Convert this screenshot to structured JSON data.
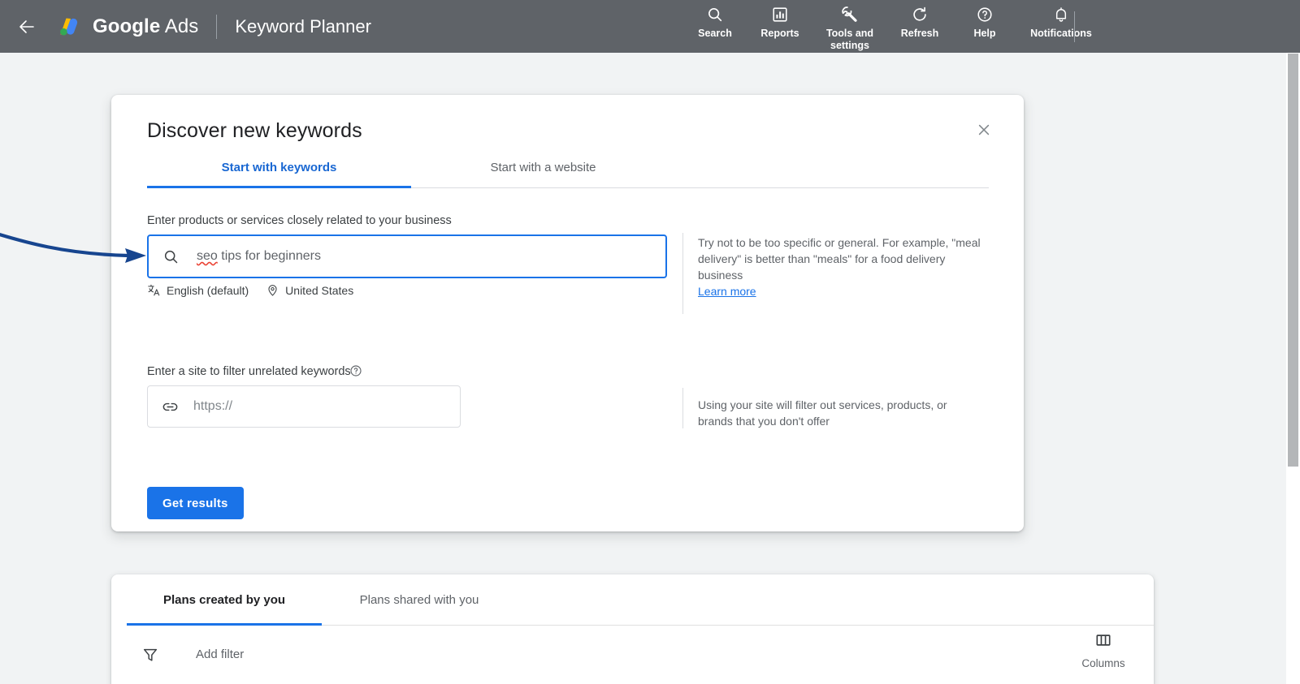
{
  "header": {
    "back_icon": "back-arrow-icon",
    "logo": "google-ads-logo",
    "brand_google": "Google",
    "brand_ads": "Ads",
    "page_name": "Keyword Planner",
    "actions": [
      {
        "label": "Search",
        "icon": "search-icon"
      },
      {
        "label": "Reports",
        "icon": "bar-chart-icon"
      },
      {
        "label": "Tools and settings",
        "icon": "wrench-icon"
      },
      {
        "label": "Refresh",
        "icon": "refresh-icon"
      },
      {
        "label": "Help",
        "icon": "help-circle-icon"
      },
      {
        "label": "Notifications",
        "icon": "bell-icon"
      }
    ]
  },
  "dialog": {
    "title": "Discover new keywords",
    "close_icon": "close-icon",
    "tabs": [
      {
        "label": "Start with keywords",
        "active": true
      },
      {
        "label": "Start with a website",
        "active": false
      }
    ],
    "keyword_field": {
      "label": "Enter products or services closely related to your business",
      "icon": "search-icon",
      "value_misspelled": "seo",
      "value_rest": " tips for beginners",
      "full_value": "seo tips for beginners"
    },
    "meta": {
      "language_icon": "translate-icon",
      "language": "English (default)",
      "location_icon": "location-pin-icon",
      "location": "United States"
    },
    "hint_keywords": {
      "text": "Try not to be too specific or general. For example, \"meal delivery\" is better than \"meals\" for a food delivery business",
      "link": "Learn more"
    },
    "site_field": {
      "label": "Enter a site to filter unrelated keywords",
      "help_icon": "help-circle-icon",
      "icon": "link-icon",
      "placeholder": "https://",
      "value": ""
    },
    "hint_site": {
      "text": "Using your site will filter out services, products, or brands that you don't offer"
    },
    "submit_label": "Get results"
  },
  "plans_panel": {
    "tabs": [
      {
        "label": "Plans created by you",
        "active": true
      },
      {
        "label": "Plans shared with you",
        "active": false
      }
    ],
    "filter_icon": "filter-funnel-icon",
    "add_filter_label": "Add filter",
    "columns_icon": "columns-icon",
    "columns_label": "Columns"
  },
  "annotation": {
    "arrow_color": "#17458f",
    "target": "keyword-input"
  },
  "colors": {
    "header_bg": "#5f6368",
    "page_bg": "#f1f3f4",
    "accent_blue": "#1a73e8",
    "text_primary": "#202124",
    "text_secondary": "#5f6368",
    "border": "#dadce0",
    "spell_error": "#ea4335"
  }
}
